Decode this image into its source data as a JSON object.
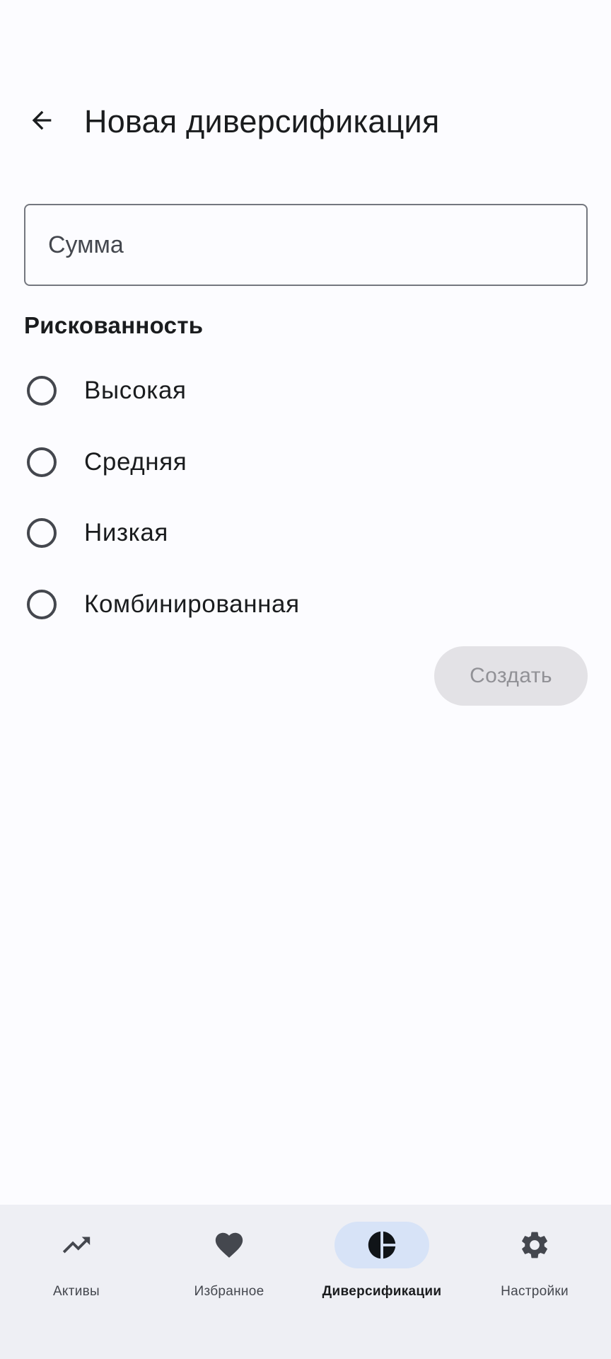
{
  "header": {
    "title": "Новая диверсификация",
    "back_icon": "arrow-back-icon"
  },
  "amount": {
    "placeholder": "Сумма",
    "value": ""
  },
  "risk": {
    "label": "Рискованность",
    "options": [
      {
        "label": "Высокая",
        "selected": false
      },
      {
        "label": "Средняя",
        "selected": false
      },
      {
        "label": "Низкая",
        "selected": false
      },
      {
        "label": "Комбинированная",
        "selected": false
      }
    ]
  },
  "actions": {
    "create_label": "Создать",
    "create_enabled": false
  },
  "bottom_nav": {
    "items": [
      {
        "label": "Активы",
        "icon": "trending-up-icon",
        "active": false
      },
      {
        "label": "Избранное",
        "icon": "heart-icon",
        "active": false
      },
      {
        "label": "Диверсификации",
        "icon": "pie-chart-icon",
        "active": true
      },
      {
        "label": "Настройки",
        "icon": "gear-icon",
        "active": false
      }
    ]
  },
  "colors": {
    "background": "#fcfcff",
    "nav_background": "#eeeff4",
    "active_pill": "#d7e3f7",
    "disabled_button": "#e3e2e6"
  }
}
